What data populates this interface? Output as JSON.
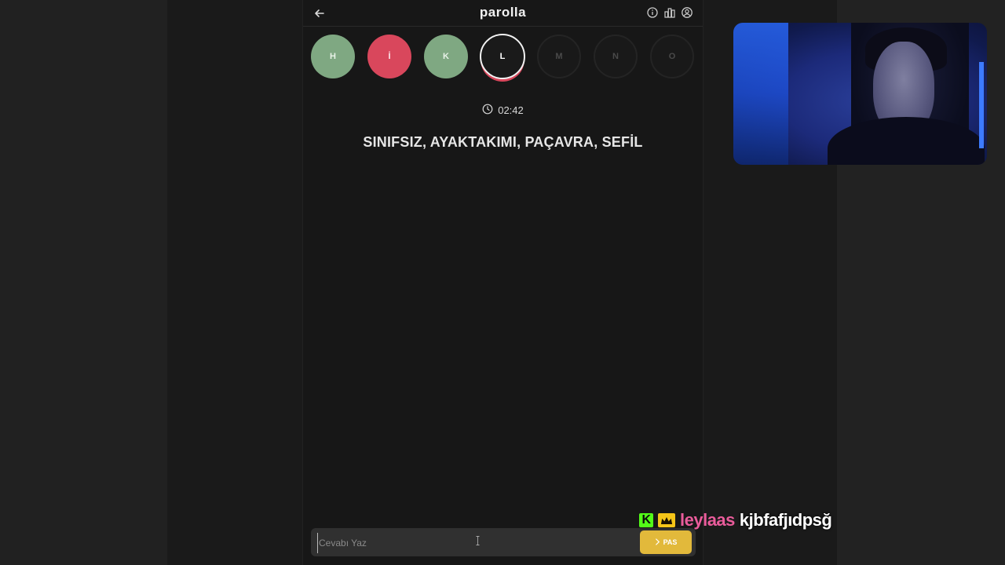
{
  "app": {
    "title": "parolla",
    "back_icon": "arrow-left-icon",
    "header_icons": [
      "info-icon",
      "stats-icon",
      "profile-icon"
    ]
  },
  "letters": [
    {
      "letter": "H",
      "state": "correct"
    },
    {
      "letter": "İ",
      "state": "wrong"
    },
    {
      "letter": "K",
      "state": "correct"
    },
    {
      "letter": "L",
      "state": "current"
    },
    {
      "letter": "M",
      "state": "pending"
    },
    {
      "letter": "N",
      "state": "pending"
    },
    {
      "letter": "O",
      "state": "pending"
    }
  ],
  "timer": {
    "value": "02:42",
    "icon": "clock-icon"
  },
  "question": {
    "text": "SINIFSIZ, AYAKTAKIMI, PAÇAVRA, SEFİL"
  },
  "answer": {
    "placeholder": "Cevabı Yaz",
    "value": "",
    "pass_label": "PAS"
  },
  "chat": {
    "username": "leylaas",
    "message": "kjbfafjıdpsğ"
  },
  "colors": {
    "correct": "#7fa882",
    "wrong": "#d9475c",
    "pass_button": "#e2b93b",
    "chat_username": "#ea5c9b",
    "kick_badge": "#53fc18"
  }
}
